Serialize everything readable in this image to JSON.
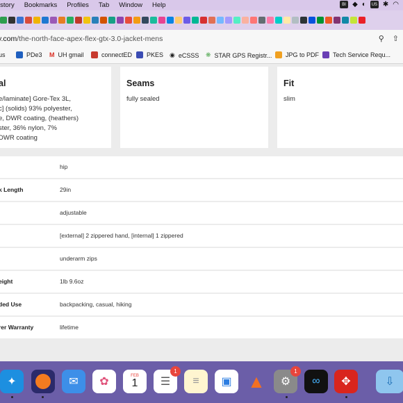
{
  "menubar": {
    "items": [
      "istory",
      "Bookmarks",
      "Profiles",
      "Tab",
      "Window",
      "Help"
    ],
    "badge_us": "US"
  },
  "address": {
    "url_host": "y.com",
    "url_path": "/the-north-face-apex-flex-gtx-3.0-jacket-mens"
  },
  "bookmarks": {
    "items": [
      "us",
      "PDe3",
      "UH gmail",
      "connectED",
      "PKES",
      "eCSSS",
      "STAR GPS Registr...",
      "JPG to PDF",
      "Tech Service Requ..."
    ]
  },
  "cards": [
    {
      "title": "al",
      "lines": [
        "e/laminate] Gore-Tex 3L,",
        "c] (solids) 93% polyester,",
        "e, DWR coating, (heathers)",
        "ster, 36% nylon, 7%",
        "DWR coating"
      ]
    },
    {
      "title": "Seams",
      "lines": [
        "fully sealed"
      ]
    },
    {
      "title": "Fit",
      "lines": [
        "slim"
      ]
    }
  ],
  "specs": [
    {
      "key": "",
      "value": "hip"
    },
    {
      "key": "k Length",
      "value": "29in"
    },
    {
      "key": "",
      "value": "adjustable"
    },
    {
      "key": "",
      "value": "[external] 2 zippered hand, [internal] 1 zippered"
    },
    {
      "key": "",
      "value": "underarm zips"
    },
    {
      "key": "eight",
      "value": "1lb 9.6oz"
    },
    {
      "key": "ded Use",
      "value": "backpacking, casual, hiking"
    },
    {
      "key": "rer Warranty",
      "value": "lifetime"
    }
  ],
  "dock": {
    "calendar_month": "FEB",
    "calendar_day": "1",
    "reminders_badge": "1",
    "settings_badge": "1"
  }
}
